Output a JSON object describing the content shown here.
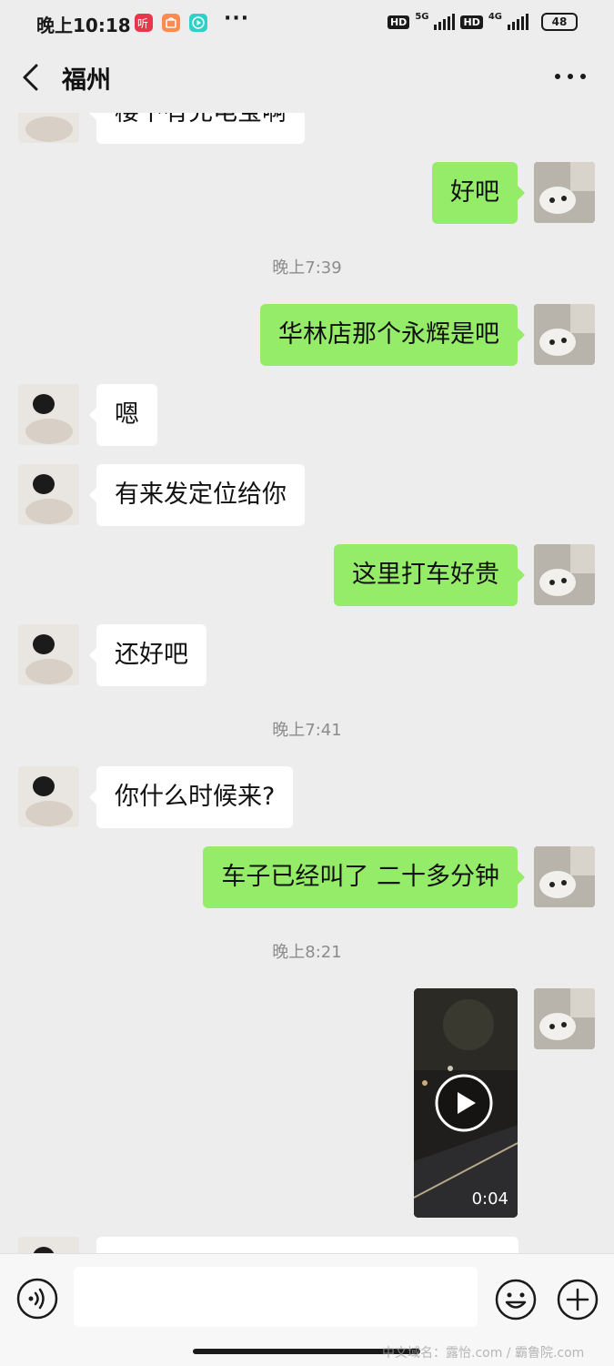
{
  "status_bar": {
    "time": "晚上10:18",
    "network_1": "5G",
    "network_2": "4G",
    "hd_1": "HD",
    "hd_2": "HD",
    "battery": "48"
  },
  "header": {
    "title": "福州"
  },
  "messages": [
    {
      "side": "left",
      "text": "楼下有充电宝啊"
    },
    {
      "side": "right",
      "text": "好吧"
    },
    {
      "timestamp": "晚上7:39"
    },
    {
      "side": "right",
      "text": "华林店那个永辉是吧"
    },
    {
      "side": "left",
      "text": "嗯"
    },
    {
      "side": "left",
      "text": "有来发定位给你"
    },
    {
      "side": "right",
      "text": "这里打车好贵"
    },
    {
      "side": "left",
      "text": "还好吧"
    },
    {
      "timestamp": "晚上7:41"
    },
    {
      "side": "left",
      "text": "你什么时候来?"
    },
    {
      "side": "right",
      "text": "车子已经叫了 二十多分钟"
    },
    {
      "timestamp": "晚上8:21"
    },
    {
      "side": "right",
      "type": "video",
      "duration": "0:04"
    }
  ],
  "input_bar": {
    "placeholder": ""
  },
  "watermark": "中文域名：露怡.com / 霸鲁院.com",
  "colors": {
    "background": "#ededed",
    "bubble_right": "#95ec69",
    "bubble_left": "#ffffff",
    "timestamp": "#8c8c8c"
  }
}
